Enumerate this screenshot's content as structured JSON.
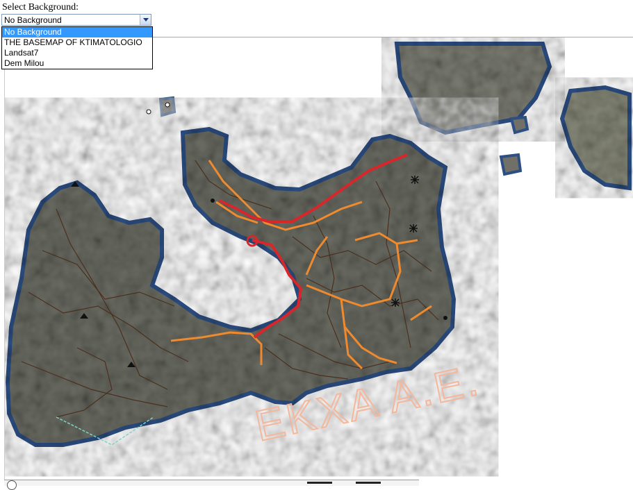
{
  "background_selector": {
    "label": "Select Background:",
    "selected": "No Background",
    "options": [
      "No Background",
      "THE BASEMAP OF KTIMATOLOGIO",
      "Landsat7",
      "Dem Milou"
    ]
  },
  "map": {
    "watermark": "EKXA A.E.",
    "colors": {
      "land": "#6f706a",
      "coast": "#34507a",
      "main_road": "#d8262a",
      "secondary_road": "#ef8a2e",
      "track": "#4a2a18",
      "watermark": "#f4b79c"
    }
  }
}
